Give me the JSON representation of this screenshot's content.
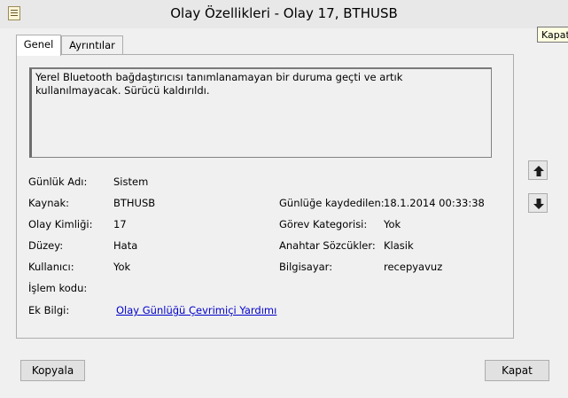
{
  "window": {
    "title": "Olay Özellikleri - Olay 17, BTHUSB",
    "close_tooltip": "Kapat",
    "app_icon": "event-log-document-icon",
    "close_icon": "close-icon"
  },
  "tabs": [
    {
      "label": "Genel",
      "active": true
    },
    {
      "label": "Ayrıntılar",
      "active": false
    }
  ],
  "description": "Yerel Bluetooth bağdaştırıcısı tanımlanamayan bir duruma geçti ve artık kullanılmayacak. Sürücü kaldırıldı.",
  "fields_left": [
    {
      "label": "Günlük Adı:",
      "value": "Sistem"
    },
    {
      "label": "Kaynak:",
      "value": "BTHUSB"
    },
    {
      "label": "Olay Kimliği:",
      "value": "17"
    },
    {
      "label": "Düzey:",
      "value": "Hata"
    },
    {
      "label": "Kullanıcı:",
      "value": "Yok"
    },
    {
      "label": "İşlem kodu:",
      "value": ""
    },
    {
      "label": "Ek Bilgi:",
      "value": "Olay Günlüğü Çevrimiçi Yardımı"
    }
  ],
  "fields_right": [
    {
      "label": "Günlüğe kaydedilen:",
      "value": "18.1.2014 00:33:38"
    },
    {
      "label": "Görev Kategorisi:",
      "value": "Yok"
    },
    {
      "label": "Anahtar Sözcükler:",
      "value": "Klasik"
    },
    {
      "label": "Bilgisayar:",
      "value": "recepyavuz"
    }
  ],
  "nav": {
    "up_icon": "arrow-up-icon",
    "down_icon": "arrow-down-icon"
  },
  "buttons": {
    "copy": "Kopyala",
    "close": "Kapat"
  }
}
